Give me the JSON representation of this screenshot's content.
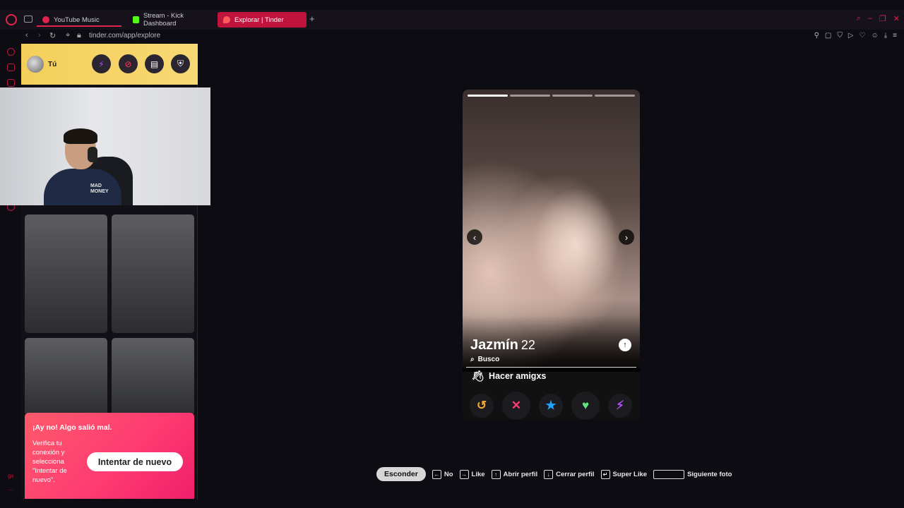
{
  "browser": {
    "tabs": [
      {
        "label": "YouTube Music"
      },
      {
        "label": "Stream - Kick Dashboard"
      },
      {
        "label": "Explorar | Tinder"
      }
    ],
    "url": "tinder.com/app/explore"
  },
  "profile": {
    "name": "Tú"
  },
  "error": {
    "title": "¡Ay no! Algo salió mal.",
    "body": "Verifica tu conexión y selecciona \"Intentar de nuevo\".",
    "retry_label": "Intentar de nuevo"
  },
  "card": {
    "name": "Jazmín",
    "age": "22",
    "looking_label": "Busco",
    "goal": "Hacer amigxs",
    "photo_progress": "1 of 4"
  },
  "shortcuts": {
    "hide_label": "Esconder",
    "items": [
      {
        "label": "No"
      },
      {
        "label": "Like"
      },
      {
        "label": "Abrir perfil"
      },
      {
        "label": "Cerrar perfil"
      },
      {
        "label": "Super Like"
      },
      {
        "label": "Siguiente foto"
      }
    ]
  },
  "webcam_overlay": {
    "shirt_text": "MAD\nMONEY"
  },
  "colors": {
    "accent": "#c0143c",
    "tinder_gradient": "#fe3c72",
    "profile_bar": "#f4cf5a"
  }
}
